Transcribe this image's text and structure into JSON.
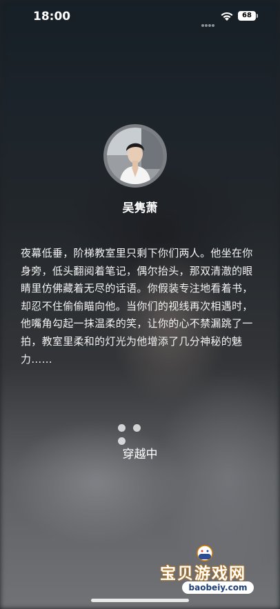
{
  "status_bar": {
    "time": "18:00",
    "battery": "68"
  },
  "character": {
    "name": "吴隽萧"
  },
  "story": {
    "text": "夜幕低垂，阶梯教室里只剩下你们两人。他坐在你身旁，低头翻阅着笔记，偶尔抬头，那双清澈的眼睛里仿佛藏着无尽的话语。你假装专注地看着书，却忍不住偷偷瞄向他。当你们的视线再次相遇时，他嘴角勾起一抹温柔的笑，让你的心不禁漏跳了一拍，教室里柔和的灯光为他增添了几分神秘的魅力……"
  },
  "loading": {
    "label": "穿越中"
  },
  "watermark": {
    "title": "宝贝游戏网",
    "url": "baobeiy.com"
  },
  "colors": {
    "text": "#ffffff",
    "watermark_outline": "#d97a00",
    "watermark_url": "#1e3e7a"
  },
  "icons": [
    "signal-icon",
    "wifi-icon",
    "battery-icon",
    "controller-logo-icon"
  ]
}
